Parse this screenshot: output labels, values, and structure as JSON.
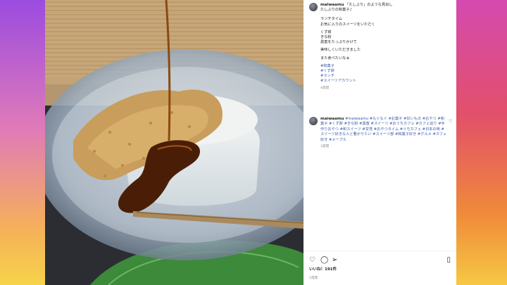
{
  "post": {
    "username": "maiwaamu",
    "caption_line1": "「久しぶり」のような見出し",
    "caption_line2": "久しぶりの和菓子♪",
    "caption_lines": [
      "ランチタイム",
      "お気に入りのスイーツをいただく",
      "",
      "くず餅",
      "きな粉",
      "黒蜜をたっぷりかけて",
      "",
      "美味しくいただきました",
      "",
      "また食べたいなぁ"
    ],
    "hashtags": [
      "#和菓子",
      "#くず餅",
      "#ランチ",
      "#スイーツアカウント"
    ],
    "time_ago": "4週間"
  },
  "comment": {
    "username": "maiwaamu",
    "text": "#maiwaamu #もぐもぐ #お菓子 #甘いもの #おやつ #和菓子 #くず餅 #きな粉 #黒蜜 #スイーツ #おうちカフェ #カフェ巡り #手作りおやつ #和スイーツ #甘党 #おやつタイム #うちカフェ #日本の味 #スイーツ好きな人と繋がりたい #スイーツ部 #和菓子好き #グルメ #カフェ好き #メープル",
    "time_ago": "3週間"
  },
  "actions": {
    "like_icon": "heart-icon",
    "comment_icon": "comment-icon",
    "share_icon": "send-icon",
    "save_icon": "bookmark-icon"
  },
  "likes_text": "いいね！191件",
  "date_text": "1週間"
}
